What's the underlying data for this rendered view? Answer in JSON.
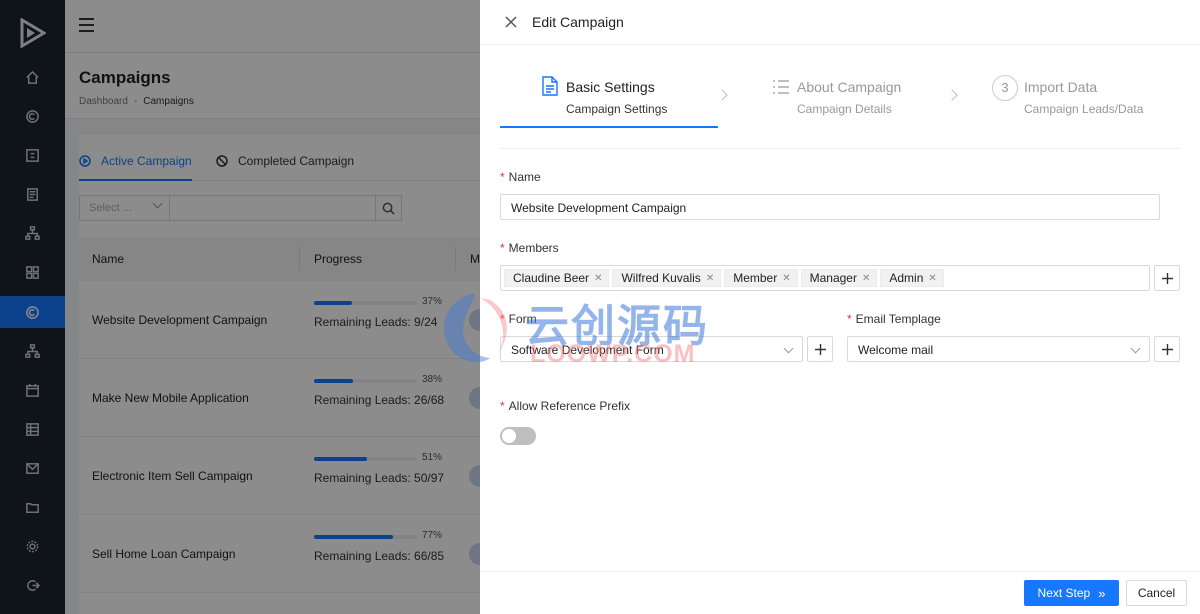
{
  "page": {
    "title": "Campaigns",
    "breadcrumb": {
      "home": "Dashboard",
      "separator": "-",
      "current": "Campaigns"
    }
  },
  "tabs": [
    {
      "label": "Active Campaign",
      "icon": "play-circle-icon",
      "active": true
    },
    {
      "label": "Completed Campaign",
      "icon": "stop-circle-icon",
      "active": false
    }
  ],
  "filter": {
    "select_placeholder": "Select ..."
  },
  "table": {
    "columns": [
      "Name",
      "Progress",
      "M"
    ],
    "rows": [
      {
        "name": "Website Development Campaign",
        "percent": "37%",
        "progress": 0.37,
        "leads": "Remaining Leads: 9/24"
      },
      {
        "name": "Make New Mobile Application",
        "percent": "38%",
        "progress": 0.38,
        "leads": "Remaining Leads: 26/68"
      },
      {
        "name": "Electronic Item Sell Campaign",
        "percent": "51%",
        "progress": 0.51,
        "leads": "Remaining Leads: 50/97"
      },
      {
        "name": "Sell Home Loan Campaign",
        "percent": "77%",
        "progress": 0.77,
        "leads": "Remaining Leads: 66/85"
      }
    ]
  },
  "drawer": {
    "title": "Edit Campaign",
    "steps": [
      {
        "number": "",
        "title": "Basic Settings",
        "subtitle": "Campaign Settings",
        "icon": "file-text-icon",
        "active": true
      },
      {
        "number": "",
        "title": "About Campaign",
        "subtitle": "Campaign Details",
        "icon": "list-icon",
        "active": false
      },
      {
        "number": "3",
        "title": "Import Data",
        "subtitle": "Campaign Leads/Data",
        "icon": "",
        "active": false
      }
    ],
    "form": {
      "name_label": "Name",
      "name_value": "Website Development Campaign",
      "members_label": "Members",
      "members": [
        "Claudine Beer",
        "Wilfred Kuvalis",
        "Member",
        "Manager",
        "Admin"
      ],
      "form_label": "Form",
      "form_value": "Software Development Form",
      "email_template_label": "Email Templage",
      "email_template_value": "Welcome mail",
      "allow_reference_prefix_label": "Allow Reference Prefix",
      "allow_reference_prefix_on": false
    },
    "footer": {
      "next_label": "Next Step",
      "cancel_label": "Cancel"
    }
  },
  "watermark": {
    "cn": "云创源码",
    "en": "LOOWP.COM"
  },
  "colors": {
    "primary": "#1677ff",
    "sidebar": "#1c2330",
    "required": "#e53935"
  }
}
